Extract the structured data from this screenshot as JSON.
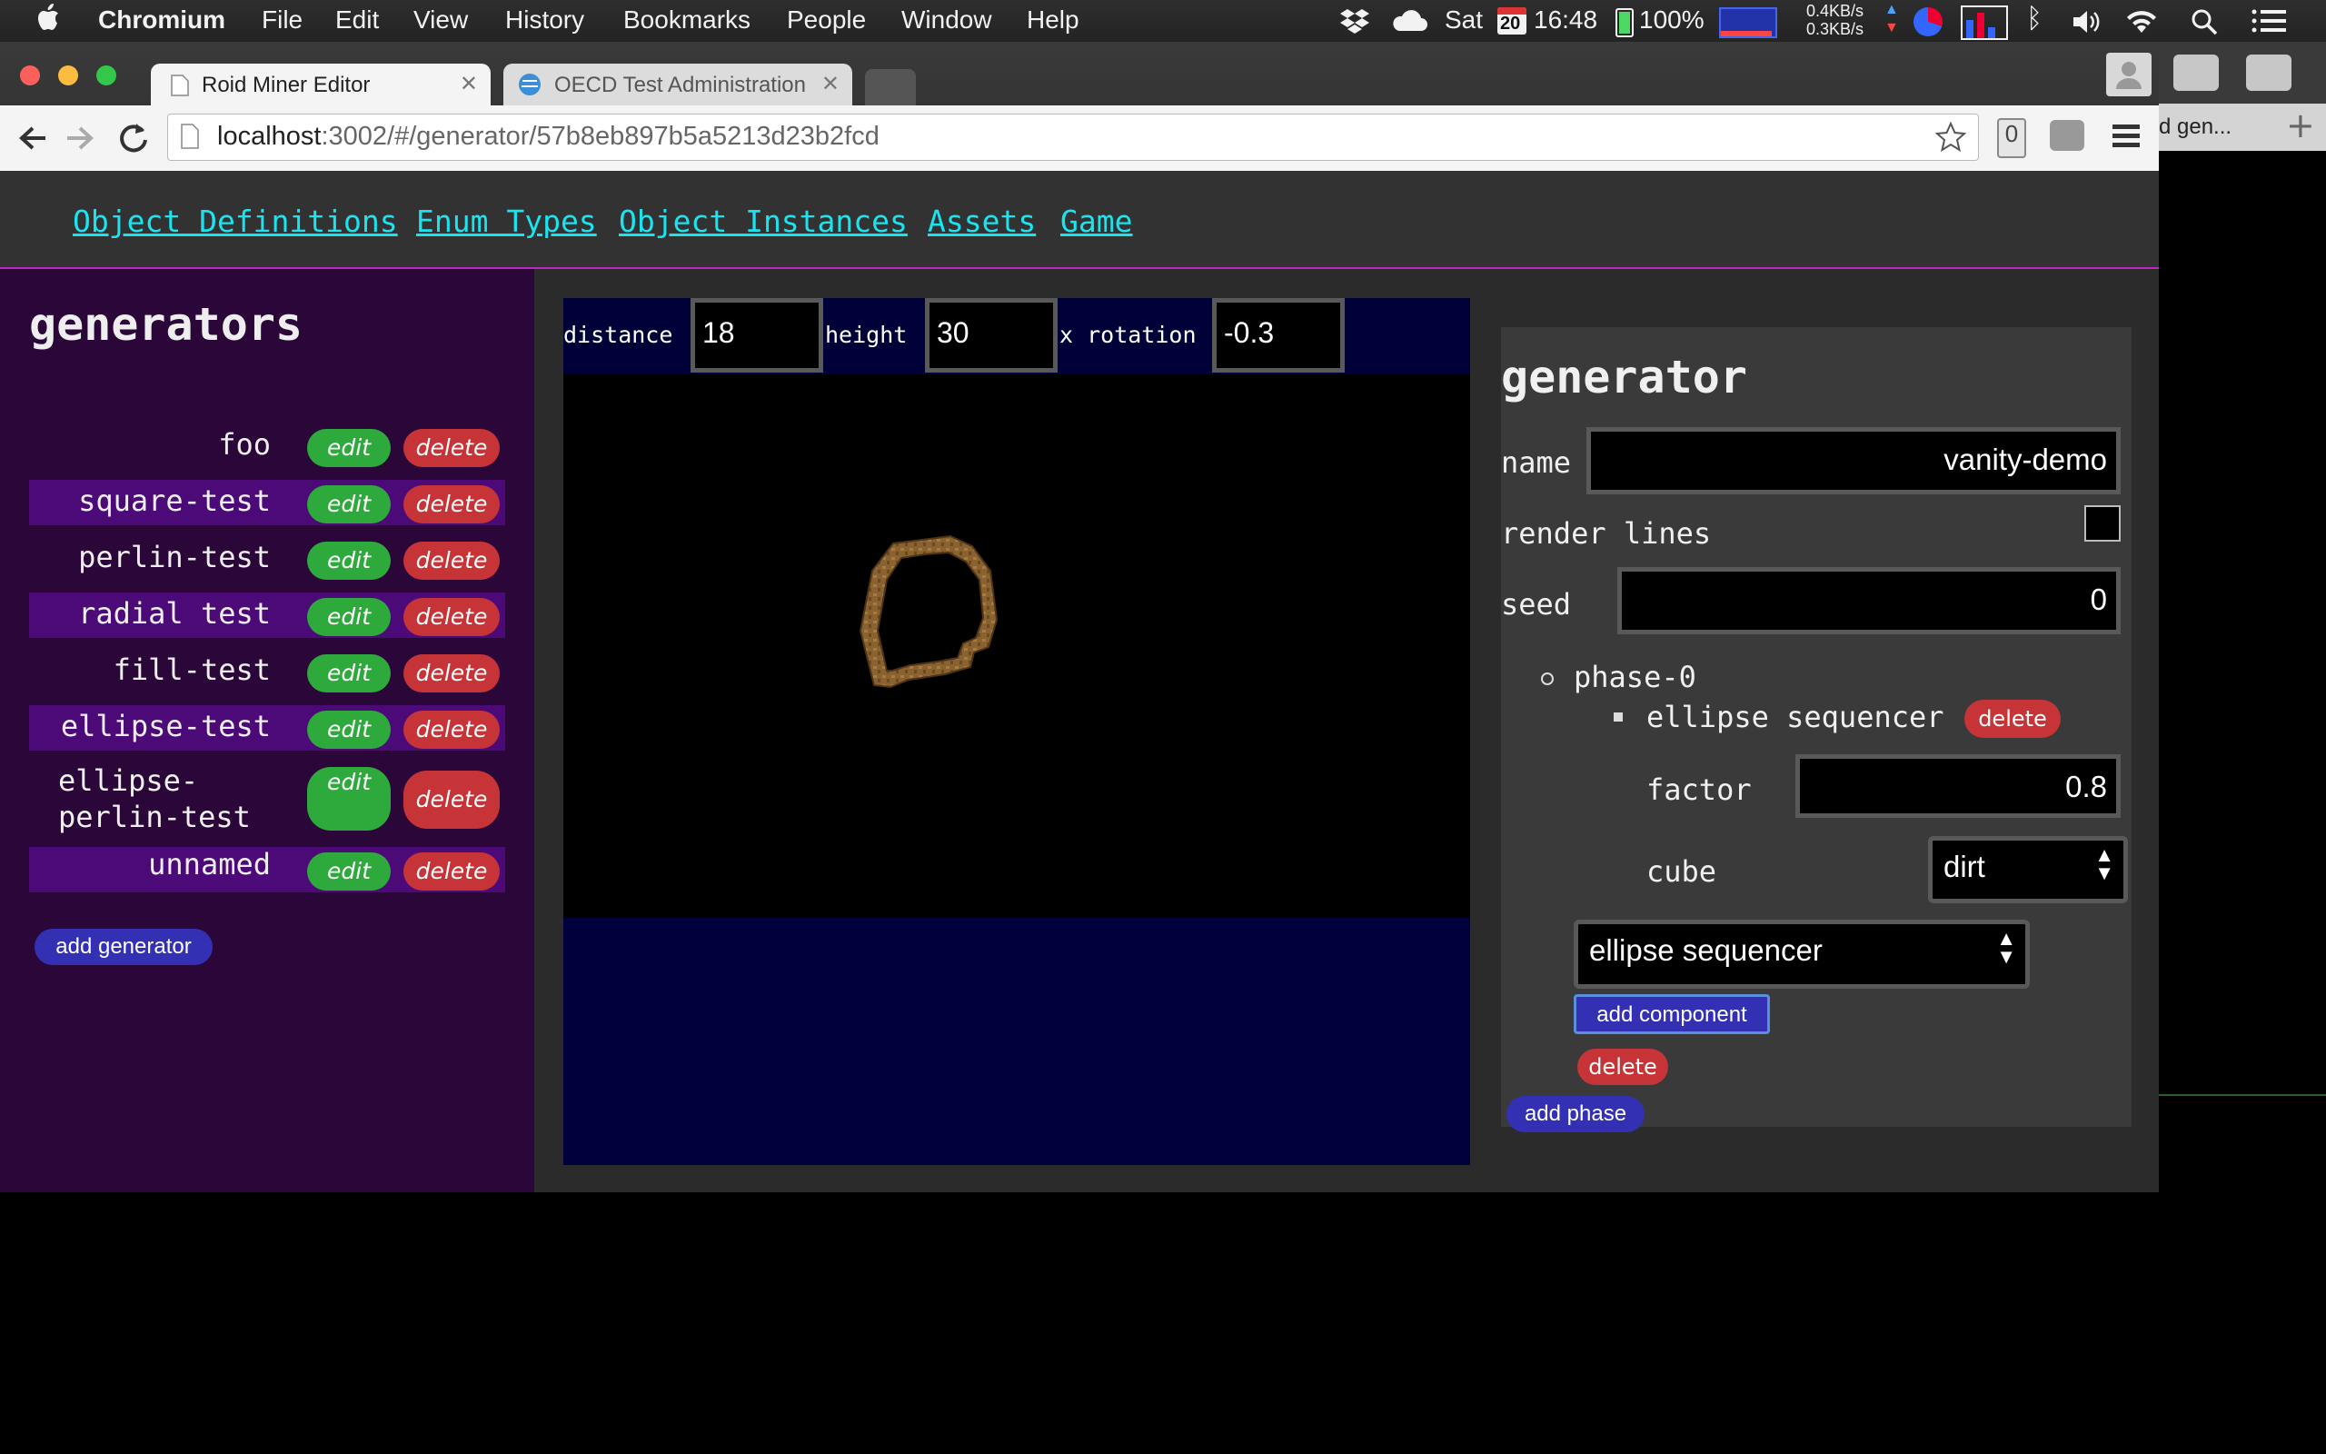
{
  "menubar": {
    "app_name": "Chromium",
    "menus": [
      "File",
      "Edit",
      "View",
      "History",
      "Bookmarks",
      "People",
      "Window",
      "Help"
    ],
    "day": "Sat",
    "calendar_date": "20",
    "time": "16:48",
    "battery": "100%",
    "net_up": "0.4KB/s",
    "net_down": "0.3KB/s"
  },
  "browser": {
    "tabs": [
      {
        "title": "Roid Miner Editor",
        "active": true
      },
      {
        "title": "OECD Test Administration",
        "active": false
      }
    ],
    "url_host": "localhost",
    "url_path": ":3002/#/generator/57b8eb897b5a5213d23b2fcd",
    "extension_badge": "0",
    "side_window_tab": "d gen..."
  },
  "nav": {
    "links": [
      "Object Definitions",
      "Enum Types",
      "Object Instances",
      "Assets",
      "Game"
    ]
  },
  "generators_panel": {
    "title": "generators",
    "edit_label": "edit",
    "delete_label": "delete",
    "items": [
      {
        "name": "foo"
      },
      {
        "name": "square-test"
      },
      {
        "name": "perlin-test"
      },
      {
        "name": "radial test"
      },
      {
        "name": "fill-test"
      },
      {
        "name": "ellipse-test"
      },
      {
        "name": "ellipse-perlin-test",
        "line1": "ellipse-",
        "line2": "perlin-test"
      },
      {
        "name": "unnamed"
      }
    ],
    "add_label": "add generator"
  },
  "viewport": {
    "distance_label": "distance",
    "distance": "18",
    "height_label": "height",
    "height": "30",
    "xrot_label": "x rotation",
    "xrot": "-0.3"
  },
  "generator_form": {
    "title": "generator",
    "name_label": "name",
    "name_value": "vanity-demo",
    "render_lines_label": "render lines",
    "render_lines_checked": false,
    "seed_label": "seed",
    "seed_value": "0",
    "phase_label": "phase-0",
    "component_label": "ellipse sequencer",
    "component_delete": "delete",
    "factor_label": "factor",
    "factor_value": "0.8",
    "cube_label": "cube",
    "cube_value": "dirt",
    "component_select": "ellipse sequencer",
    "add_component": "add component",
    "phase_delete": "delete",
    "add_phase": "add phase"
  },
  "colors": {
    "nav_link": "#19e4f0",
    "generators_bg": "#2b0638",
    "row_highlight": "#4c0a78",
    "edit_green": "#2eaa3c",
    "delete_red": "#c63437",
    "button_blue": "#3430b4",
    "viewport_blue": "#000038",
    "cube_brown": "#8a6230"
  }
}
